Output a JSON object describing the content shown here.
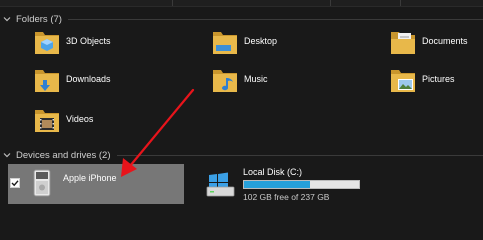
{
  "folders_group": {
    "header": "Folders (7)",
    "items": [
      {
        "label": "3D Objects",
        "icon": "3d-objects-folder-icon"
      },
      {
        "label": "Desktop",
        "icon": "desktop-folder-icon"
      },
      {
        "label": "Documents",
        "icon": "documents-folder-icon"
      },
      {
        "label": "Downloads",
        "icon": "downloads-folder-icon"
      },
      {
        "label": "Music",
        "icon": "music-folder-icon"
      },
      {
        "label": "Pictures",
        "icon": "pictures-folder-icon"
      },
      {
        "label": "Videos",
        "icon": "videos-folder-icon"
      }
    ]
  },
  "devices_group": {
    "header": "Devices and drives (2)",
    "apple_iphone": {
      "label": "Apple iPhone",
      "checked": true
    },
    "local_disk": {
      "label": "Local Disk (C:)",
      "free_text": "102 GB free of 237 GB",
      "used_fraction": 0.57
    }
  },
  "colors": {
    "background": "#191919",
    "folder_yellow": "#e8b84a",
    "selection_bg": "#777777",
    "usage_bar": "#26a0da",
    "annotation_arrow": "#e8141b"
  }
}
